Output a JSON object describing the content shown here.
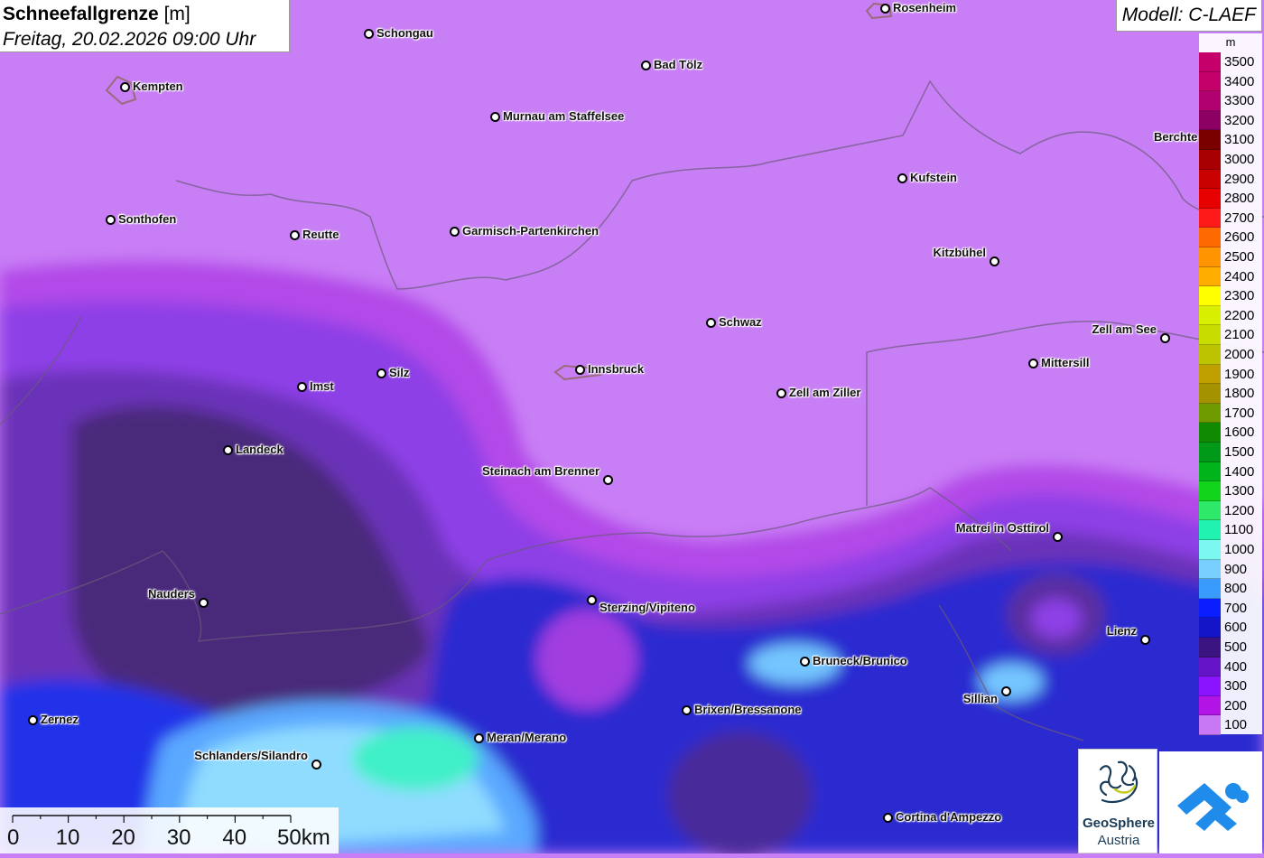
{
  "title": {
    "main": "Schneefallgrenze",
    "unit": "[m]",
    "subtitle": "Freitag, 20.02.2026 09:00 Uhr"
  },
  "model": "Modell: C-LAEF",
  "legend": {
    "unit": "m",
    "levels": [
      {
        "label": "3500",
        "color": "#c6006a"
      },
      {
        "label": "3400",
        "color": "#c4006a"
      },
      {
        "label": "3300",
        "color": "#b1006f"
      },
      {
        "label": "3200",
        "color": "#8c0064"
      },
      {
        "label": "3100",
        "color": "#7a0000"
      },
      {
        "label": "3000",
        "color": "#a80000"
      },
      {
        "label": "2900",
        "color": "#c80000"
      },
      {
        "label": "2800",
        "color": "#e60000"
      },
      {
        "label": "2700",
        "color": "#ff1a1a"
      },
      {
        "label": "2600",
        "color": "#ff6a00"
      },
      {
        "label": "2500",
        "color": "#ff9300"
      },
      {
        "label": "2400",
        "color": "#ffae00"
      },
      {
        "label": "2300",
        "color": "#ffff00"
      },
      {
        "label": "2200",
        "color": "#d8f000"
      },
      {
        "label": "2100",
        "color": "#c8dc00"
      },
      {
        "label": "2000",
        "color": "#bcc300"
      },
      {
        "label": "1900",
        "color": "#c0a000"
      },
      {
        "label": "1800",
        "color": "#a49200"
      },
      {
        "label": "1700",
        "color": "#6e9a00"
      },
      {
        "label": "1600",
        "color": "#108a00"
      },
      {
        "label": "1500",
        "color": "#009a18"
      },
      {
        "label": "1400",
        "color": "#00b41c"
      },
      {
        "label": "1300",
        "color": "#12d41a"
      },
      {
        "label": "1200",
        "color": "#2ee86a"
      },
      {
        "label": "1100",
        "color": "#22f2b0"
      },
      {
        "label": "1000",
        "color": "#7cf8f0"
      },
      {
        "label": "900",
        "color": "#78cfff"
      },
      {
        "label": "800",
        "color": "#3a9bff"
      },
      {
        "label": "700",
        "color": "#0a1eff"
      },
      {
        "label": "600",
        "color": "#1414c8"
      },
      {
        "label": "500",
        "color": "#3c1482"
      },
      {
        "label": "400",
        "color": "#6614c8"
      },
      {
        "label": "300",
        "color": "#8a14ff"
      },
      {
        "label": "200",
        "color": "#b214e6"
      },
      {
        "label": "100",
        "color": "#c878f5"
      }
    ]
  },
  "cities": [
    {
      "name": "Rosenheim"
    },
    {
      "name": "Schongau"
    },
    {
      "name": "Kempten"
    },
    {
      "name": "Bad Tölz"
    },
    {
      "name": "Murnau am Staffelsee"
    },
    {
      "name": "Berchte"
    },
    {
      "name": "Kufstein"
    },
    {
      "name": "Sonthofen"
    },
    {
      "name": "Reutte"
    },
    {
      "name": "Garmisch-Partenkirchen"
    },
    {
      "name": "Kitzbühel"
    },
    {
      "name": "Schwaz"
    },
    {
      "name": "Zell am See"
    },
    {
      "name": "Mittersill"
    },
    {
      "name": "Innsbruck"
    },
    {
      "name": "Imst"
    },
    {
      "name": "Silz"
    },
    {
      "name": "Zell am Ziller"
    },
    {
      "name": "Landeck"
    },
    {
      "name": "Steinach am Brenner"
    },
    {
      "name": "Matrei in Osttirol"
    },
    {
      "name": "Nauders"
    },
    {
      "name": "Sterzing/Vipiteno"
    },
    {
      "name": "Lienz"
    },
    {
      "name": "Bruneck/Brunico"
    },
    {
      "name": "Sillian"
    },
    {
      "name": "Brixen/Bressanone"
    },
    {
      "name": "Zernez"
    },
    {
      "name": "Meran/Merano"
    },
    {
      "name": "Schlanders/Silandro"
    },
    {
      "name": "Cortina d'Ampezzo"
    }
  ],
  "scale": {
    "ticks": [
      "0",
      "10",
      "20",
      "30",
      "40",
      "50km"
    ]
  },
  "logos": {
    "geosphere_line1": "GeoSphere",
    "geosphere_line2": "Austria"
  }
}
